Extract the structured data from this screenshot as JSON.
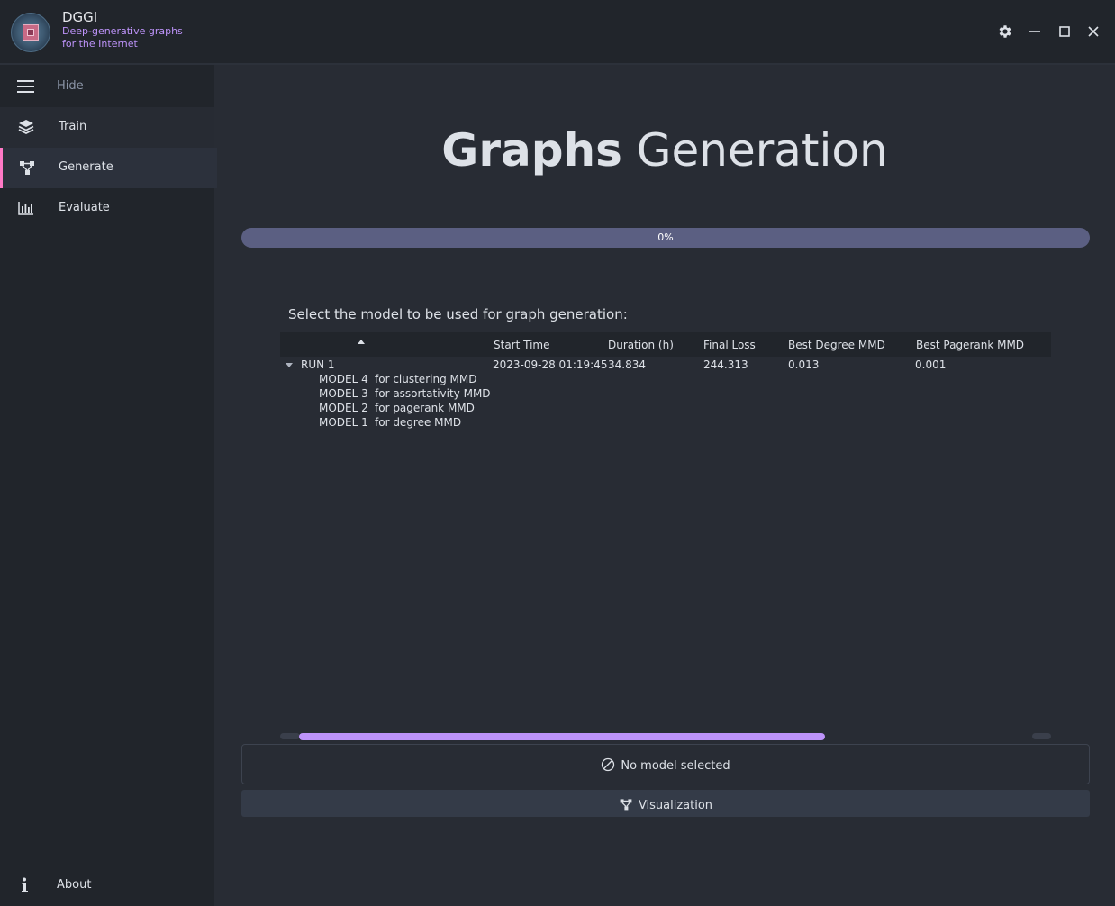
{
  "app": {
    "title": "DGGI",
    "subtitle": "Deep-generative graphs for the Internet"
  },
  "window_controls": {
    "settings_icon": "gear-icon",
    "minimize_icon": "minimize-icon",
    "maximize_icon": "maximize-icon",
    "close_icon": "close-icon"
  },
  "sidebar": {
    "toggle_label": "Hide",
    "items": [
      {
        "label": "Train",
        "icon": "layers-icon"
      },
      {
        "label": "Generate",
        "icon": "graph-nodes-icon",
        "active": true
      },
      {
        "label": "Evaluate",
        "icon": "bar-chart-icon"
      }
    ],
    "about_label": "About"
  },
  "main": {
    "title_bold": "Graphs",
    "title_rest": "Generation",
    "progress": {
      "value": 0,
      "text": "0%"
    },
    "select_prompt": "Select the model to be used for graph generation:",
    "table": {
      "columns": [
        "",
        "Start Time",
        "Duration (h)",
        "Final Loss",
        "Best Degree MMD",
        "Best Pagerank MMD"
      ],
      "runs": [
        {
          "name": "RUN 1",
          "start_time": "2023-09-28 01:19:45",
          "duration": "34.834",
          "final_loss": "244.313",
          "best_degree_mmd": "0.013",
          "best_pagerank_mmd": "0.001",
          "models": [
            {
              "name": "MODEL 4",
              "desc": "for clustering MMD"
            },
            {
              "name": "MODEL 3",
              "desc": "for assortativity MMD"
            },
            {
              "name": "MODEL 2",
              "desc": "for pagerank MMD"
            },
            {
              "name": "MODEL 1",
              "desc": "for degree MMD"
            }
          ]
        }
      ]
    },
    "selection_status": "No model selected",
    "visualization_label": "Visualization"
  },
  "colors": {
    "accent_purple": "#bd93f9",
    "active_marker": "#ff79c6",
    "background": "#282c34",
    "sidebar": "#21252b",
    "progress_track": "#5b5f82"
  }
}
